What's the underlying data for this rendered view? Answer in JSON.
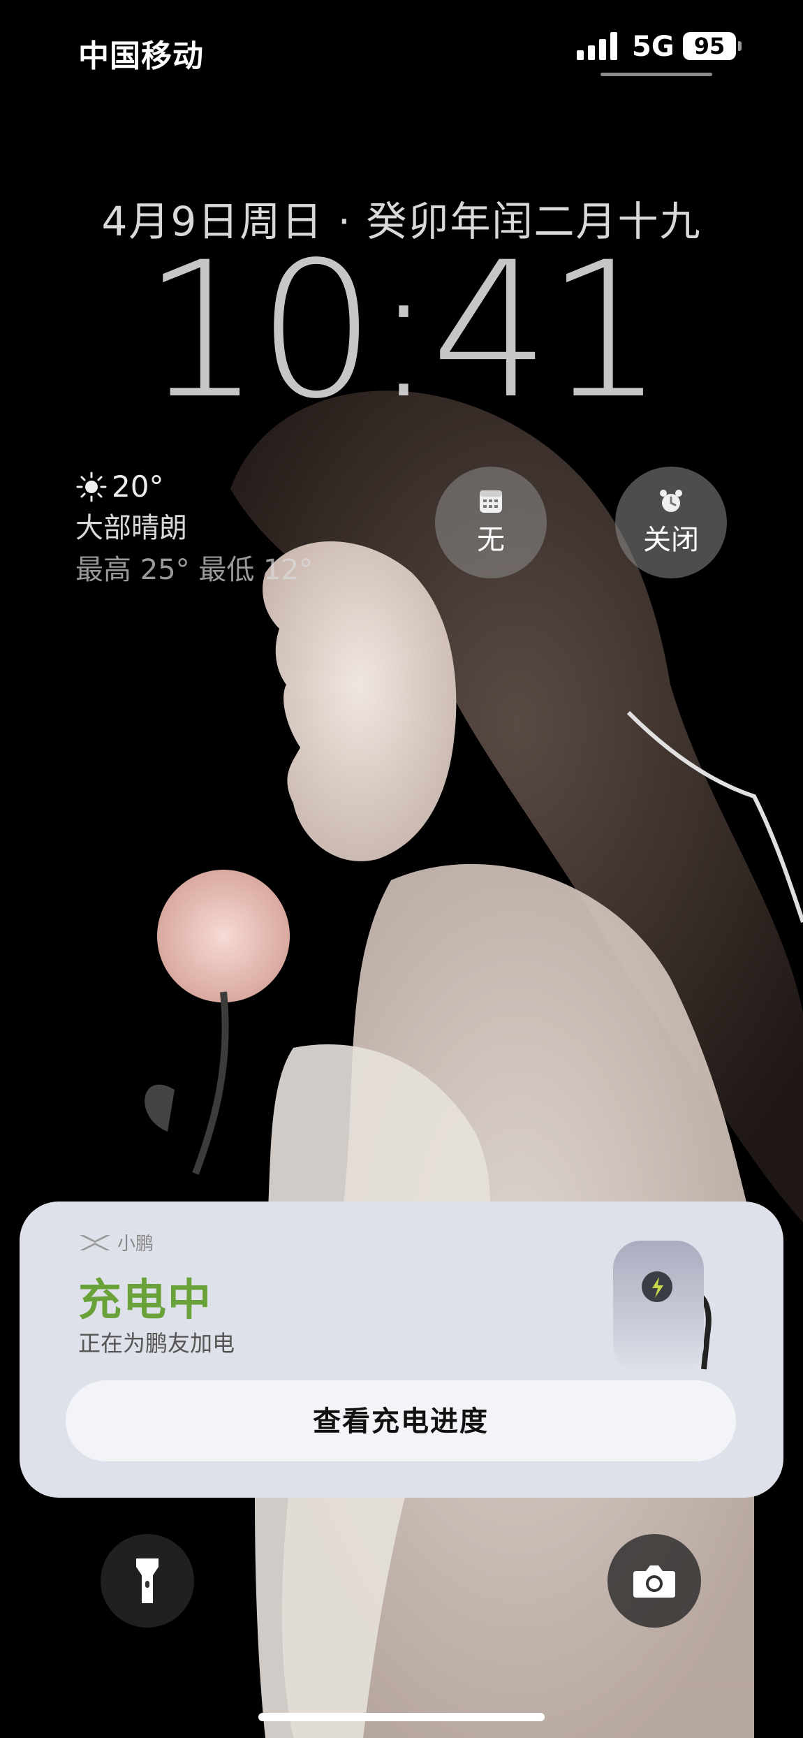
{
  "status_bar": {
    "carrier": "中国移动",
    "network": "5G",
    "battery": "95"
  },
  "lock_screen": {
    "date": "4月9日周日 · 癸卯年闰二月十九",
    "time": "10:41"
  },
  "weather": {
    "icon": "sun-icon",
    "temperature": "20°",
    "condition": "大部晴朗",
    "range": "最高 25° 最低 12°"
  },
  "widgets": [
    {
      "icon": "calendar-icon",
      "label": "无"
    },
    {
      "icon": "alarm-clock-icon",
      "label": "关闭"
    }
  ],
  "notification": {
    "app_name": "小鹏",
    "title": "充电中",
    "subtitle": "正在为鹏友加电",
    "button_label": "查看充电进度",
    "title_color": "#6aa23a"
  },
  "bottom_controls": {
    "left_icon": "flashlight-icon",
    "right_icon": "camera-icon"
  }
}
